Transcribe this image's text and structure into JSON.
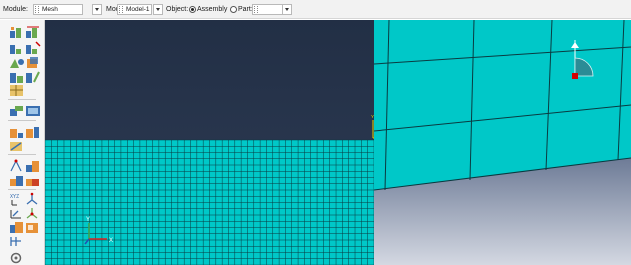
{
  "context_bar": {
    "module_label": "Module:",
    "module_value": "Mesh",
    "model_label": "Model:",
    "model_value": "Model-1",
    "object_label": "Object:",
    "assembly_label": "Assembly",
    "part_label": "Part:",
    "part_value": "",
    "selected_object": "Assembly"
  },
  "toolbox": {
    "icons": [
      "seed-part-instance-icon",
      "seed-edges-icon",
      "seed-by-number-icon",
      "delete-seeds-icon",
      "mesh-controls-icon",
      "element-type-icon",
      "verify-mesh-icon",
      "mesh-stats-icon",
      "mesh-part-icon",
      "mesh-region-icon",
      "delete-mesh-icon",
      "partition-edge-icon",
      "partition-face-icon",
      "partition-cell-icon",
      "create-datum-icon",
      "datum-point-icon",
      "virtual-topology-icon",
      "merge-icon",
      "edit-mesh-icon",
      "adaptivity-icon",
      "query-icon",
      "display-group-icon",
      "tools-icon"
    ]
  },
  "viewport": {
    "background_top": "#263348",
    "mesh_color": "#00c8c8",
    "mesh_line_color": "#0a3a40",
    "triad_labels": {
      "x": "X",
      "y": "Y"
    },
    "left_elements_per_row": 52,
    "left_mesh_rows": 20
  },
  "colors": {
    "accent": "#00c8c8",
    "toolbar_bg": "#f2f2f2"
  }
}
